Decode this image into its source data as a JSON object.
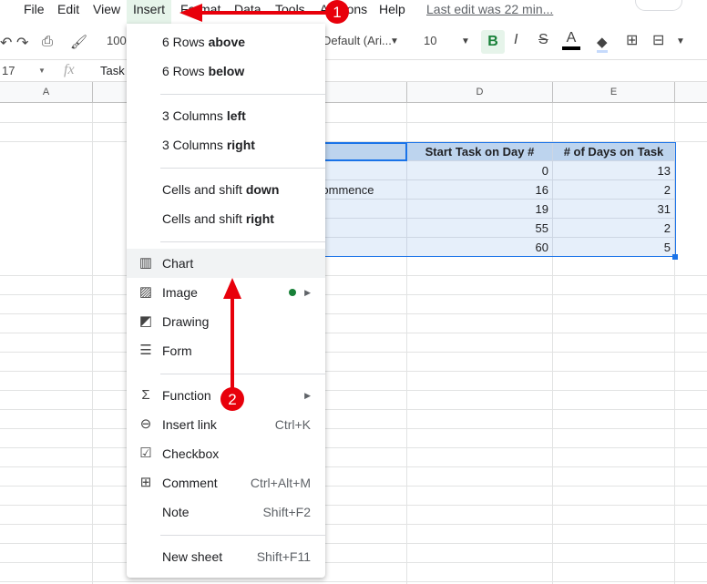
{
  "menubar": {
    "items": [
      "File",
      "Edit",
      "View",
      "Insert",
      "Format",
      "Data",
      "Tools",
      "Add-ons",
      "Help"
    ],
    "last_edit": "Last edit was 22 min..."
  },
  "toolbar": {
    "zoom": "100%",
    "font": "Default (Ari...",
    "font_size": "10",
    "bold": "B",
    "italic": "I",
    "strike": "S",
    "text_color": "A"
  },
  "formula_bar": {
    "cell_ref": "17",
    "fx": "fx",
    "content": "Task"
  },
  "columns": [
    "A",
    "D",
    "E"
  ],
  "table": {
    "headers": [
      "Start Task on Day #",
      "# of Days on Task"
    ],
    "partial_text": "Commence",
    "rows": [
      [
        0,
        13
      ],
      [
        16,
        2
      ],
      [
        19,
        31
      ],
      [
        55,
        2
      ],
      [
        60,
        5
      ]
    ]
  },
  "insert_menu": {
    "rows_above": [
      "6 Rows ",
      "above"
    ],
    "rows_below": [
      "6 Rows ",
      "below"
    ],
    "cols_left": [
      "3 Columns ",
      "left"
    ],
    "cols_right": [
      "3 Columns ",
      "right"
    ],
    "cells_down": [
      "Cells and shift ",
      "down"
    ],
    "cells_right": [
      "Cells and shift ",
      "right"
    ],
    "items": [
      {
        "label": "Chart",
        "icon": "chart-icon"
      },
      {
        "label": "Image",
        "icon": "image-icon"
      },
      {
        "label": "Drawing",
        "icon": "drawing-icon"
      },
      {
        "label": "Form",
        "icon": "form-icon"
      },
      {
        "label": "Function",
        "icon": "sigma-icon"
      },
      {
        "label": "Insert link",
        "icon": "link-icon",
        "shortcut": "Ctrl+K"
      },
      {
        "label": "Checkbox",
        "icon": "checkbox-icon"
      },
      {
        "label": "Comment",
        "icon": "comment-icon",
        "shortcut": "Ctrl+Alt+M"
      },
      {
        "label": "Note",
        "shortcut": "Shift+F2"
      },
      {
        "label": "New sheet",
        "shortcut": "Shift+F11"
      }
    ]
  },
  "annotations": {
    "step1": "1",
    "step2": "2",
    "color": "#e8000b"
  }
}
